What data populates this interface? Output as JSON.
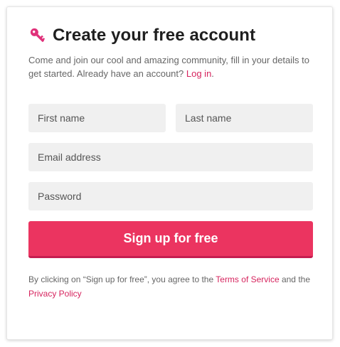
{
  "header": {
    "title": "Create your free account",
    "icon": "key-icon",
    "accent_color": "#e0317a"
  },
  "intro": {
    "text": "Come and join our cool and amazing community, fill in your details to get started. Already have an account? ",
    "login_link": "Log in",
    "trailing": "."
  },
  "form": {
    "first_name_placeholder": "First name",
    "last_name_placeholder": "Last name",
    "email_placeholder": "Email address",
    "password_placeholder": "Password",
    "submit_label": "Sign up for free",
    "submit_color": "#eb3460"
  },
  "terms": {
    "prefix": "By clicking on “Sign up for free”, you agree to the ",
    "tos_link": "Terms of Service",
    "middle": " and the ",
    "privacy_link": "Privacy Policy",
    "link_color": "#d6245e"
  }
}
